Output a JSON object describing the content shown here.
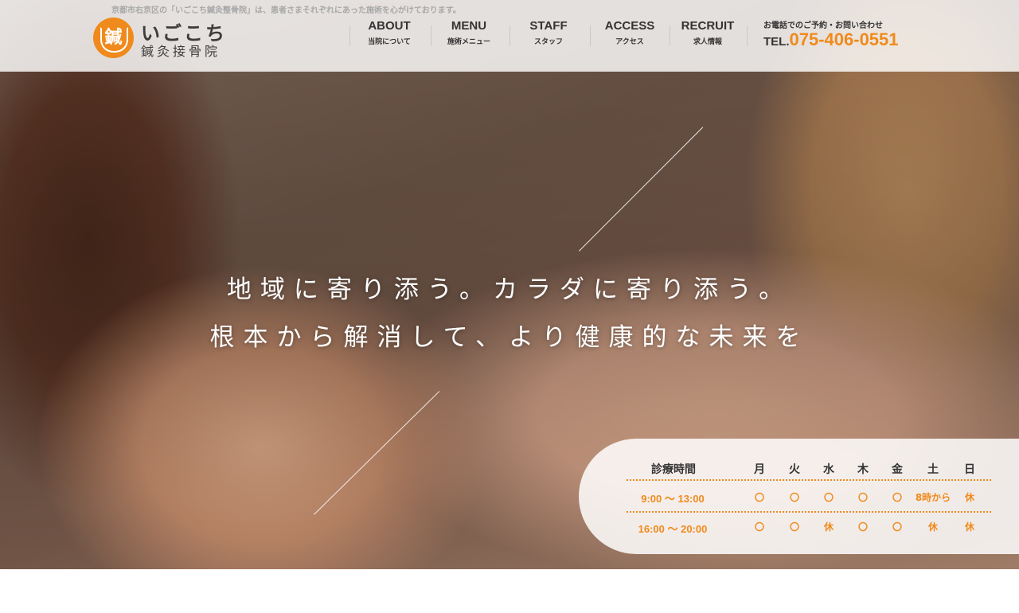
{
  "header": {
    "tagline": "京都市右京区の「いごこち鍼灸整骨院」は、患者さまそれぞれにあった施術を心がけております。",
    "logo": {
      "name": "いごこち",
      "sub": "鍼灸接骨院",
      "mark_glyph": "鍼"
    },
    "nav": [
      {
        "en": "ABOUT",
        "ja": "当院について"
      },
      {
        "en": "MENU",
        "ja": "施術メニュー"
      },
      {
        "en": "STAFF",
        "ja": "スタッフ"
      },
      {
        "en": "ACCESS",
        "ja": "アクセス"
      },
      {
        "en": "RECRUIT",
        "ja": "求人情報"
      }
    ],
    "tel": {
      "label": "お電話でのご予約・お問い合わせ",
      "prefix": "TEL.",
      "number": "075-406-0551"
    }
  },
  "hero": {
    "line1": "地域に寄り添う。カラダに寄り添う。",
    "line2": "根本から解消して、より健康的な未来を"
  },
  "hours": {
    "title": "診療時間",
    "days": [
      "月",
      "火",
      "水",
      "木",
      "金",
      "土",
      "日"
    ],
    "rows": [
      {
        "time": "9:00 〜 13:00",
        "values": [
          "〇",
          "〇",
          "〇",
          "〇",
          "〇",
          "8時から",
          "休"
        ]
      },
      {
        "time": "16:00 〜 20:00",
        "values": [
          "〇",
          "〇",
          "休",
          "〇",
          "〇",
          "休",
          "休"
        ]
      }
    ]
  },
  "colors": {
    "accent": "#f08a1c",
    "text": "#333333"
  }
}
